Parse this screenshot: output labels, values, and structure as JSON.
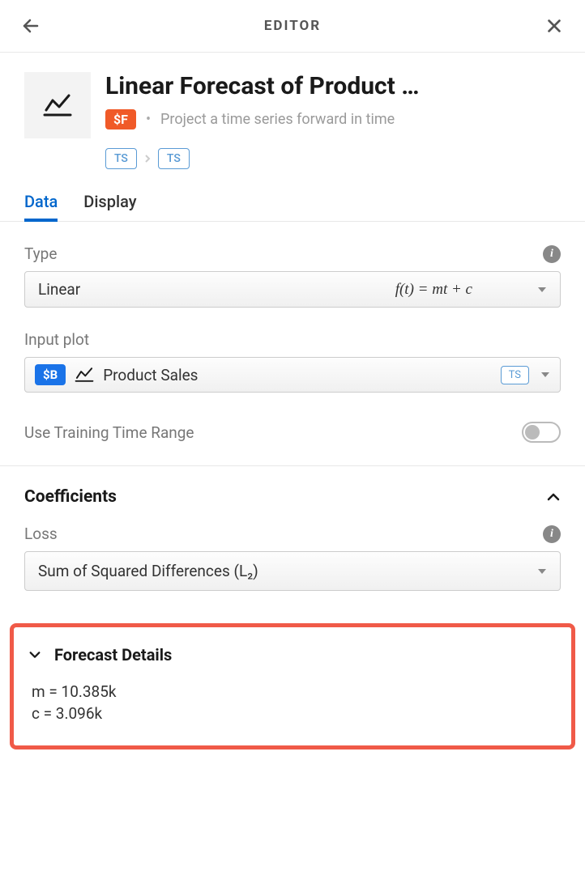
{
  "header": {
    "title": "EDITOR"
  },
  "main": {
    "title": "Linear Forecast of Product …",
    "badge": "$F",
    "description": "Project a time series forward in time",
    "ts_in": "TS",
    "ts_out": "TS"
  },
  "tabs": {
    "data": "Data",
    "display": "Display"
  },
  "type": {
    "label": "Type",
    "value": "Linear",
    "formula": "f(t) = mt + c"
  },
  "input_plot": {
    "label": "Input plot",
    "badge": "$B",
    "name": "Product Sales",
    "ts": "TS"
  },
  "training": {
    "label": "Use Training Time Range"
  },
  "coefficients": {
    "title": "Coefficients",
    "loss_label": "Loss",
    "loss_value": "Sum of Squared Differences (L₂)"
  },
  "details": {
    "title": "Forecast Details",
    "m": "m = 10.385k",
    "c": "c = 3.096k"
  }
}
